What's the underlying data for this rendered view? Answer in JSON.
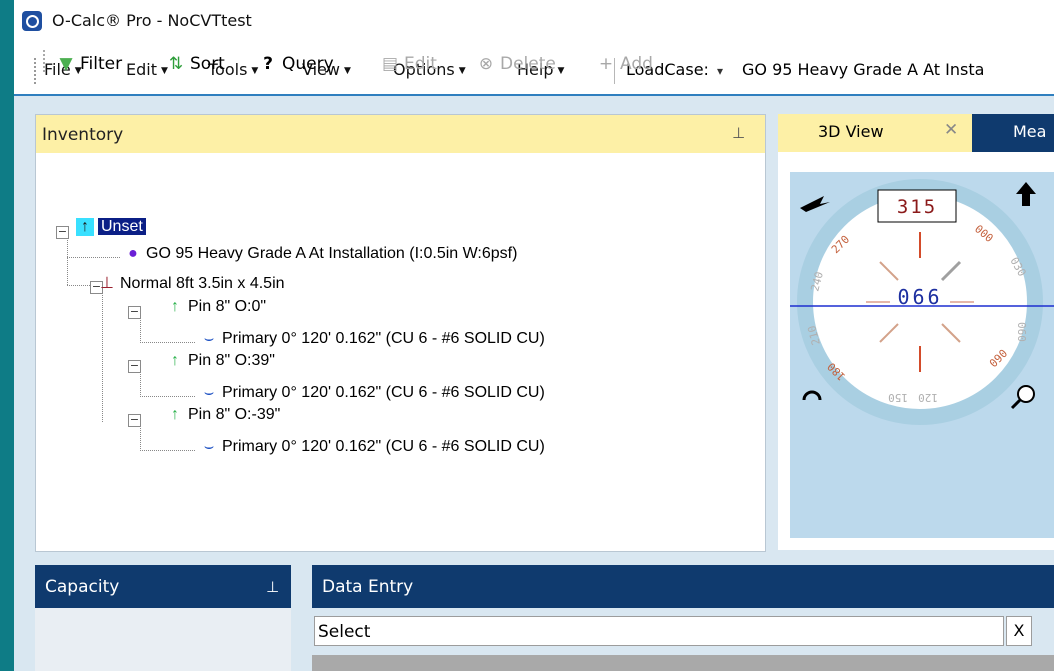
{
  "window": {
    "title": "O-Calc® Pro - NoCVTtest"
  },
  "menu": {
    "items": [
      "File",
      "Edit",
      "Tools",
      "View",
      "Options",
      "Help"
    ],
    "loadcase_label": "LoadCase:",
    "loadcase_value": "GO 95 Heavy Grade A At Insta"
  },
  "inventory": {
    "title": "Inventory",
    "toolbar": {
      "filter": "Filter",
      "sort": "Sort",
      "query": "Query",
      "edit": "Edit",
      "delete": "Delete",
      "add": "Add"
    },
    "tree": {
      "root": "Unset",
      "loadcase": "GO 95 Heavy Grade A At Installation (I:0.5in W:6psf)",
      "crossarm": "Normal 8ft  3.5in x 4.5in",
      "pins": [
        {
          "label": "Pin 8\" O:0\"",
          "wire": "Primary 0° 120'  0.162\"   (CU 6 - #6 SOLID CU)"
        },
        {
          "label": "Pin 8\" O:39\"",
          "wire": "Primary 0° 120'  0.162\"   (CU 6 - #6 SOLID CU)"
        },
        {
          "label": "Pin 8\" O:-39\"",
          "wire": "Primary 0° 120'  0.162\"   (CU 6 - #6 SOLID CU)"
        }
      ]
    }
  },
  "view3d": {
    "tab_label": "3D View",
    "tab_close": "✕",
    "other_tab_label": "Mea",
    "compass": {
      "heading_top": "315",
      "heading_center": "066",
      "ring_labels": [
        "270",
        "240",
        "210",
        "180",
        "150",
        "120",
        "090",
        "060",
        "030",
        "000"
      ]
    }
  },
  "capacity": {
    "title": "Capacity"
  },
  "data_entry": {
    "title": "Data Entry",
    "select_text": "Select",
    "clear_label": "X"
  },
  "icons": {
    "pin": "pin-icon",
    "filter": "filter-icon",
    "sort": "sort-icon",
    "query": "query-icon",
    "edit": "edit-icon",
    "delete": "delete-icon",
    "add": "add-icon"
  },
  "colors": {
    "accent_teal": "#0e7c86",
    "panel_header_yellow": "#fdf0a6",
    "panel_header_navy": "#0f3a6e",
    "compass_blue": "#bcd9ec"
  }
}
